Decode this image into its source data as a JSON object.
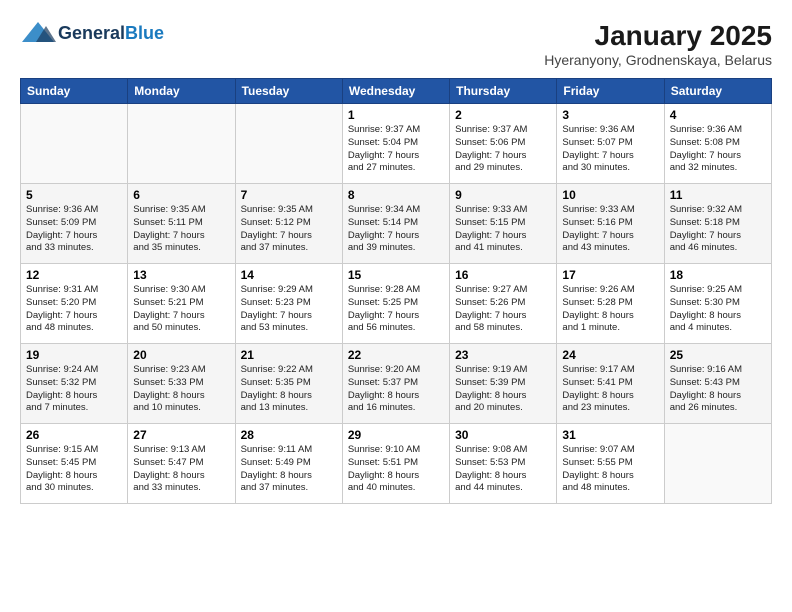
{
  "logo": {
    "general": "General",
    "blue": "Blue"
  },
  "title": {
    "month": "January 2025",
    "location": "Hyeranyony, Grodnenskaya, Belarus"
  },
  "headers": [
    "Sunday",
    "Monday",
    "Tuesday",
    "Wednesday",
    "Thursday",
    "Friday",
    "Saturday"
  ],
  "weeks": [
    [
      {
        "day": "",
        "content": ""
      },
      {
        "day": "",
        "content": ""
      },
      {
        "day": "",
        "content": ""
      },
      {
        "day": "1",
        "content": "Sunrise: 9:37 AM\nSunset: 5:04 PM\nDaylight: 7 hours\nand 27 minutes."
      },
      {
        "day": "2",
        "content": "Sunrise: 9:37 AM\nSunset: 5:06 PM\nDaylight: 7 hours\nand 29 minutes."
      },
      {
        "day": "3",
        "content": "Sunrise: 9:36 AM\nSunset: 5:07 PM\nDaylight: 7 hours\nand 30 minutes."
      },
      {
        "day": "4",
        "content": "Sunrise: 9:36 AM\nSunset: 5:08 PM\nDaylight: 7 hours\nand 32 minutes."
      }
    ],
    [
      {
        "day": "5",
        "content": "Sunrise: 9:36 AM\nSunset: 5:09 PM\nDaylight: 7 hours\nand 33 minutes."
      },
      {
        "day": "6",
        "content": "Sunrise: 9:35 AM\nSunset: 5:11 PM\nDaylight: 7 hours\nand 35 minutes."
      },
      {
        "day": "7",
        "content": "Sunrise: 9:35 AM\nSunset: 5:12 PM\nDaylight: 7 hours\nand 37 minutes."
      },
      {
        "day": "8",
        "content": "Sunrise: 9:34 AM\nSunset: 5:14 PM\nDaylight: 7 hours\nand 39 minutes."
      },
      {
        "day": "9",
        "content": "Sunrise: 9:33 AM\nSunset: 5:15 PM\nDaylight: 7 hours\nand 41 minutes."
      },
      {
        "day": "10",
        "content": "Sunrise: 9:33 AM\nSunset: 5:16 PM\nDaylight: 7 hours\nand 43 minutes."
      },
      {
        "day": "11",
        "content": "Sunrise: 9:32 AM\nSunset: 5:18 PM\nDaylight: 7 hours\nand 46 minutes."
      }
    ],
    [
      {
        "day": "12",
        "content": "Sunrise: 9:31 AM\nSunset: 5:20 PM\nDaylight: 7 hours\nand 48 minutes."
      },
      {
        "day": "13",
        "content": "Sunrise: 9:30 AM\nSunset: 5:21 PM\nDaylight: 7 hours\nand 50 minutes."
      },
      {
        "day": "14",
        "content": "Sunrise: 9:29 AM\nSunset: 5:23 PM\nDaylight: 7 hours\nand 53 minutes."
      },
      {
        "day": "15",
        "content": "Sunrise: 9:28 AM\nSunset: 5:25 PM\nDaylight: 7 hours\nand 56 minutes."
      },
      {
        "day": "16",
        "content": "Sunrise: 9:27 AM\nSunset: 5:26 PM\nDaylight: 7 hours\nand 58 minutes."
      },
      {
        "day": "17",
        "content": "Sunrise: 9:26 AM\nSunset: 5:28 PM\nDaylight: 8 hours\nand 1 minute."
      },
      {
        "day": "18",
        "content": "Sunrise: 9:25 AM\nSunset: 5:30 PM\nDaylight: 8 hours\nand 4 minutes."
      }
    ],
    [
      {
        "day": "19",
        "content": "Sunrise: 9:24 AM\nSunset: 5:32 PM\nDaylight: 8 hours\nand 7 minutes."
      },
      {
        "day": "20",
        "content": "Sunrise: 9:23 AM\nSunset: 5:33 PM\nDaylight: 8 hours\nand 10 minutes."
      },
      {
        "day": "21",
        "content": "Sunrise: 9:22 AM\nSunset: 5:35 PM\nDaylight: 8 hours\nand 13 minutes."
      },
      {
        "day": "22",
        "content": "Sunrise: 9:20 AM\nSunset: 5:37 PM\nDaylight: 8 hours\nand 16 minutes."
      },
      {
        "day": "23",
        "content": "Sunrise: 9:19 AM\nSunset: 5:39 PM\nDaylight: 8 hours\nand 20 minutes."
      },
      {
        "day": "24",
        "content": "Sunrise: 9:17 AM\nSunset: 5:41 PM\nDaylight: 8 hours\nand 23 minutes."
      },
      {
        "day": "25",
        "content": "Sunrise: 9:16 AM\nSunset: 5:43 PM\nDaylight: 8 hours\nand 26 minutes."
      }
    ],
    [
      {
        "day": "26",
        "content": "Sunrise: 9:15 AM\nSunset: 5:45 PM\nDaylight: 8 hours\nand 30 minutes."
      },
      {
        "day": "27",
        "content": "Sunrise: 9:13 AM\nSunset: 5:47 PM\nDaylight: 8 hours\nand 33 minutes."
      },
      {
        "day": "28",
        "content": "Sunrise: 9:11 AM\nSunset: 5:49 PM\nDaylight: 8 hours\nand 37 minutes."
      },
      {
        "day": "29",
        "content": "Sunrise: 9:10 AM\nSunset: 5:51 PM\nDaylight: 8 hours\nand 40 minutes."
      },
      {
        "day": "30",
        "content": "Sunrise: 9:08 AM\nSunset: 5:53 PM\nDaylight: 8 hours\nand 44 minutes."
      },
      {
        "day": "31",
        "content": "Sunrise: 9:07 AM\nSunset: 5:55 PM\nDaylight: 8 hours\nand 48 minutes."
      },
      {
        "day": "",
        "content": ""
      }
    ]
  ]
}
